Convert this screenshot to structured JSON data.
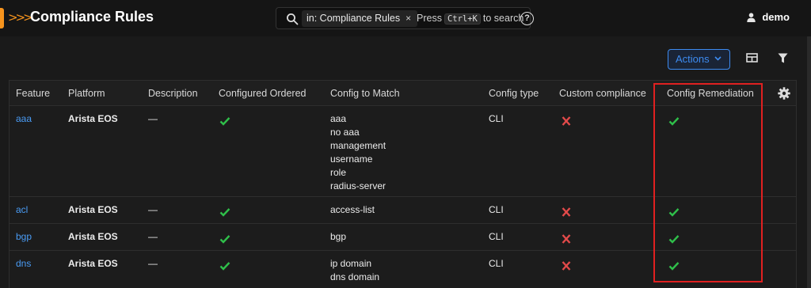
{
  "header": {
    "title": "Compliance Rules",
    "search": {
      "chip": "in: Compliance Rules",
      "chip_close": "×",
      "hint_prefix": "Press",
      "shortcut": "Ctrl+K",
      "hint_suffix": "to search",
      "help": "?"
    },
    "user": "demo"
  },
  "toolbar": {
    "actions_label": "Actions"
  },
  "table": {
    "columns": [
      "Feature",
      "Platform",
      "Description",
      "Configured Ordered",
      "Config to Match",
      "Config type",
      "Custom compliance",
      "Config Remediation"
    ],
    "rows": [
      {
        "feature": "aaa",
        "platform": "Arista EOS",
        "description": "—",
        "configured_ordered": true,
        "config_to_match": [
          "aaa",
          "no aaa",
          "management",
          "username",
          "role",
          "radius-server"
        ],
        "config_type": "CLI",
        "custom_compliance": false,
        "config_remediation": true
      },
      {
        "feature": "acl",
        "platform": "Arista EOS",
        "description": "—",
        "configured_ordered": true,
        "config_to_match": [
          "access-list"
        ],
        "config_type": "CLI",
        "custom_compliance": false,
        "config_remediation": true
      },
      {
        "feature": "bgp",
        "platform": "Arista EOS",
        "description": "—",
        "configured_ordered": true,
        "config_to_match": [
          "bgp"
        ],
        "config_type": "CLI",
        "custom_compliance": false,
        "config_remediation": true
      },
      {
        "feature": "dns",
        "platform": "Arista EOS",
        "description": "—",
        "configured_ordered": true,
        "config_to_match": [
          "ip domain",
          "dns domain"
        ],
        "config_type": "CLI",
        "custom_compliance": false,
        "config_remediation": true
      }
    ]
  },
  "colors": {
    "accent": "#f7941d",
    "link": "#4a9cf5",
    "check": "#2fbf4a",
    "cross": "#e24a4a",
    "highlight": "#e02020"
  },
  "icons": {
    "true_value": "check-icon",
    "false_value": "x-icon"
  }
}
